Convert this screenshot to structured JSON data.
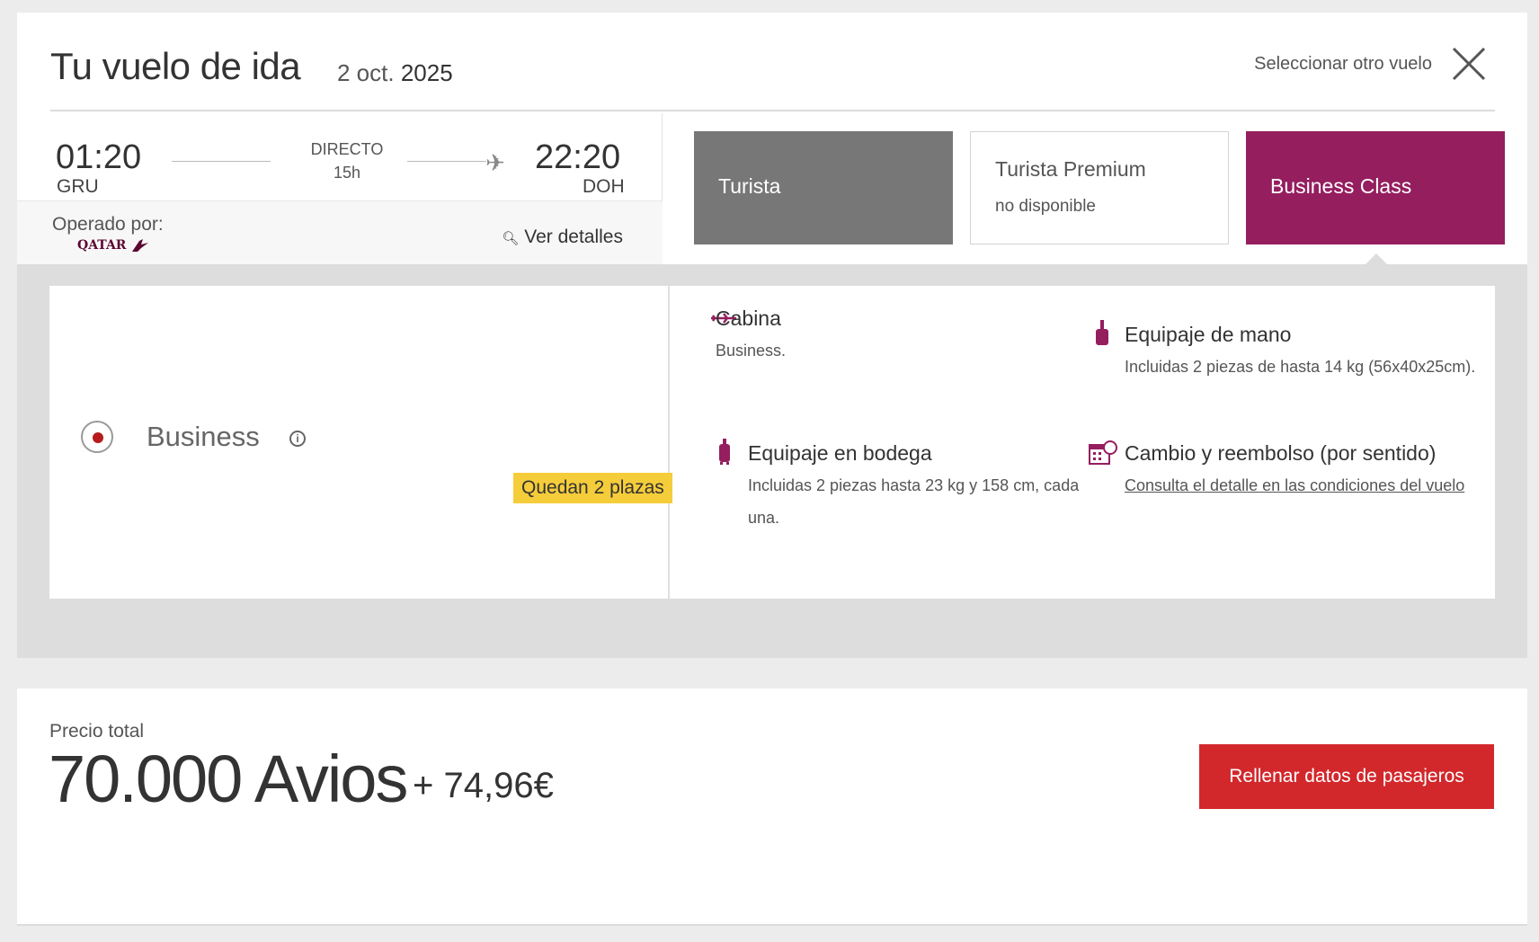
{
  "header": {
    "title": "Tu vuelo de ida",
    "date_prefix": "2 oct.",
    "date_year": "2025",
    "select_other": "Seleccionar otro vuelo"
  },
  "flight": {
    "departure_time": "01:20",
    "departure_code": "GRU",
    "arrival_time": "22:20",
    "arrival_code": "DOH",
    "type": "DIRECTO",
    "duration": "15h",
    "operated_by_label": "Operado por:",
    "carrier_logo_text": "QATAR",
    "details_link": "Ver detalles"
  },
  "fares": [
    {
      "label": "Turista",
      "sub": ""
    },
    {
      "label": "Turista Premium",
      "sub": "no disponible"
    },
    {
      "label": "Business Class",
      "sub": ""
    }
  ],
  "selected_fare": {
    "label": "Business",
    "seats_left": "Quedan 2 plazas"
  },
  "features": {
    "cabin": {
      "title": "Cabina",
      "desc": "Business."
    },
    "hand": {
      "title": "Equipaje de mano",
      "desc": "Incluidas 2 piezas de hasta 14 kg (56x40x25cm)."
    },
    "hold": {
      "title": "Equipaje en bodega",
      "desc": "Incluidas 2 piezas hasta 23 kg y 158 cm, cada una."
    },
    "change": {
      "title": "Cambio y reembolso (por sentido)",
      "link": "Consulta el detalle en las condiciones del vuelo"
    }
  },
  "price": {
    "label": "Precio total",
    "avios": "70.000 Avios",
    "plus": "+ 74,96€",
    "cta": "Rellenar datos de pasajeros"
  },
  "colors": {
    "brand": "#951e5f",
    "cta": "#d2282c",
    "badge": "#f5cc3a"
  }
}
